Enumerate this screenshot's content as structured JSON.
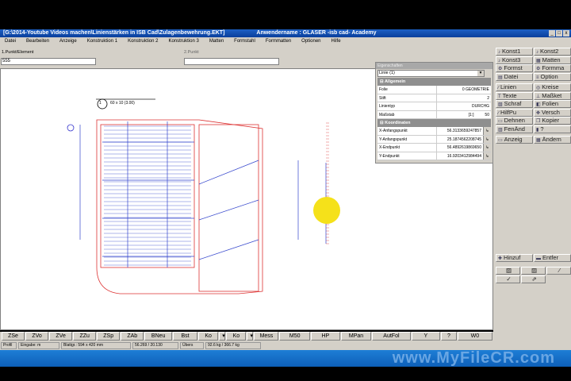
{
  "window": {
    "title": "[G:\\2014-Youtube Videos machen\\Linienstärken in ISB Cad\\Zulagenbewehrung.EKT]",
    "user": "Anwendername : GLASER -isb cad- Academy",
    "controls": [
      "_",
      "□",
      "x"
    ]
  },
  "menu": [
    "Datei",
    "Bearbeiten",
    "Anzeige",
    "Konstruktion 1",
    "Konstruktion 2",
    "Konstruktion 3",
    "Matten",
    "Formstahl",
    "Formmatten",
    "Optionen",
    "Hilfe"
  ],
  "inputs": {
    "p1_label": "1.Punkt/Element",
    "p1_value": "555",
    "p2_label": "2.Punkt",
    "p2_value": ""
  },
  "drawing": {
    "label_num": "1",
    "label_text": "60 x 10 (3.00)",
    "cursor_color": "#f5e11a"
  },
  "properties": {
    "title": "Eigenschaften",
    "selected": "Linie (1)",
    "section1": "Allgemein",
    "general": [
      {
        "k": "Folie",
        "v": "0   GEOMETRIE"
      },
      {
        "k": "Stift",
        "v": "2"
      },
      {
        "k": "Linientyp",
        "v": "DURCHG"
      },
      {
        "k": "Maßstab",
        "v": "[1:]          50"
      }
    ],
    "section2": "Koordinaten",
    "coords": [
      {
        "k": "X-Anfangspunkt",
        "v": "56.3133659247857"
      },
      {
        "k": "Y-Anfangspunkt",
        "v": "25.1874562208745"
      },
      {
        "k": "X-Endpunkt",
        "v": "56.4892619869650"
      },
      {
        "k": "Y-Endpunkt",
        "v": "16.9203412984494"
      }
    ]
  },
  "right_buttons": [
    "Konst1",
    "Konst2",
    "Konst3",
    "Matten",
    "Formst",
    "Formma",
    "Datei",
    "Option",
    "Linien",
    "Kreise",
    "Texte",
    "Maßket",
    "Schraf",
    "Folien",
    "HilfPu",
    "Versch",
    "Dehnen",
    "Kopier",
    "FenÄnd",
    "?",
    "Anzeig",
    "Ändern"
  ],
  "right_lower": {
    "add": "Hinzuf",
    "remove": "Entfer"
  },
  "toolbar": [
    "ZSe",
    "ZVo",
    "ZVe",
    "ZZu",
    "ZSp",
    "ZAb",
    "BNeu",
    "Bst",
    "Ko",
    "▾",
    "Ko",
    "▾",
    "Mess",
    "M50",
    "HP",
    "MPan",
    "AutFol",
    "Y",
    "?",
    "W0"
  ],
  "status": [
    "Profil",
    "Eingabe: m",
    "Blattgr.: 594 x 420 mm",
    "56.269 / 20.130",
    "Übers",
    "92.6 kg / 366.7 kg"
  ],
  "watermark": "www.MyFileCR.com"
}
